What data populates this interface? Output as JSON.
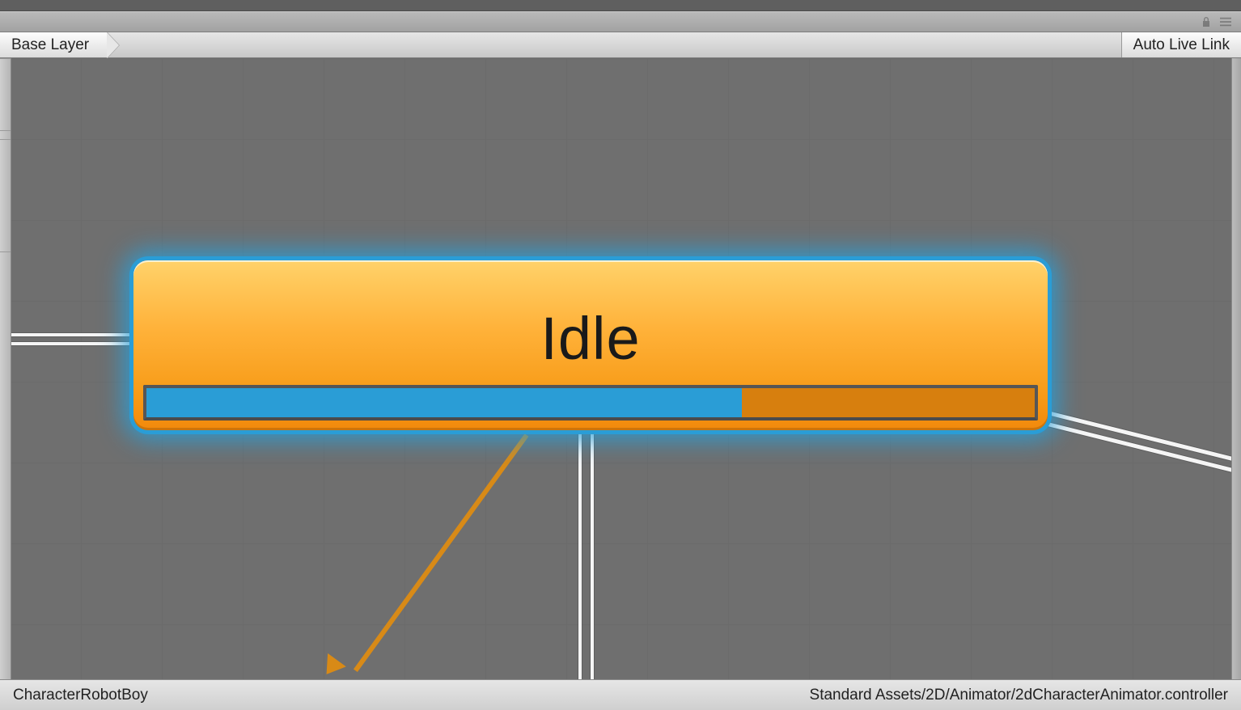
{
  "toolbar": {
    "breadcrumb": "Base Layer",
    "auto_live_link": "Auto Live Link"
  },
  "icons": {
    "lock": "lock-icon",
    "menu": "list-menu-icon"
  },
  "node": {
    "label": "Idle",
    "progress_percent": 67
  },
  "statusbar": {
    "object_name": "CharacterRobotBoy",
    "asset_path": "Standard Assets/2D/Animator/2dCharacterAnimator.controller"
  },
  "colors": {
    "node_fill_top": "#ffd26a",
    "node_fill_bottom": "#f2890c",
    "selection_glow": "#2a9dd6",
    "progress_fill": "#2a9dd6",
    "progress_track": "#d77f0e",
    "transition_line": "#f5f5f5",
    "transition_orange": "#d88a17",
    "canvas_bg": "#6f6f6f"
  }
}
